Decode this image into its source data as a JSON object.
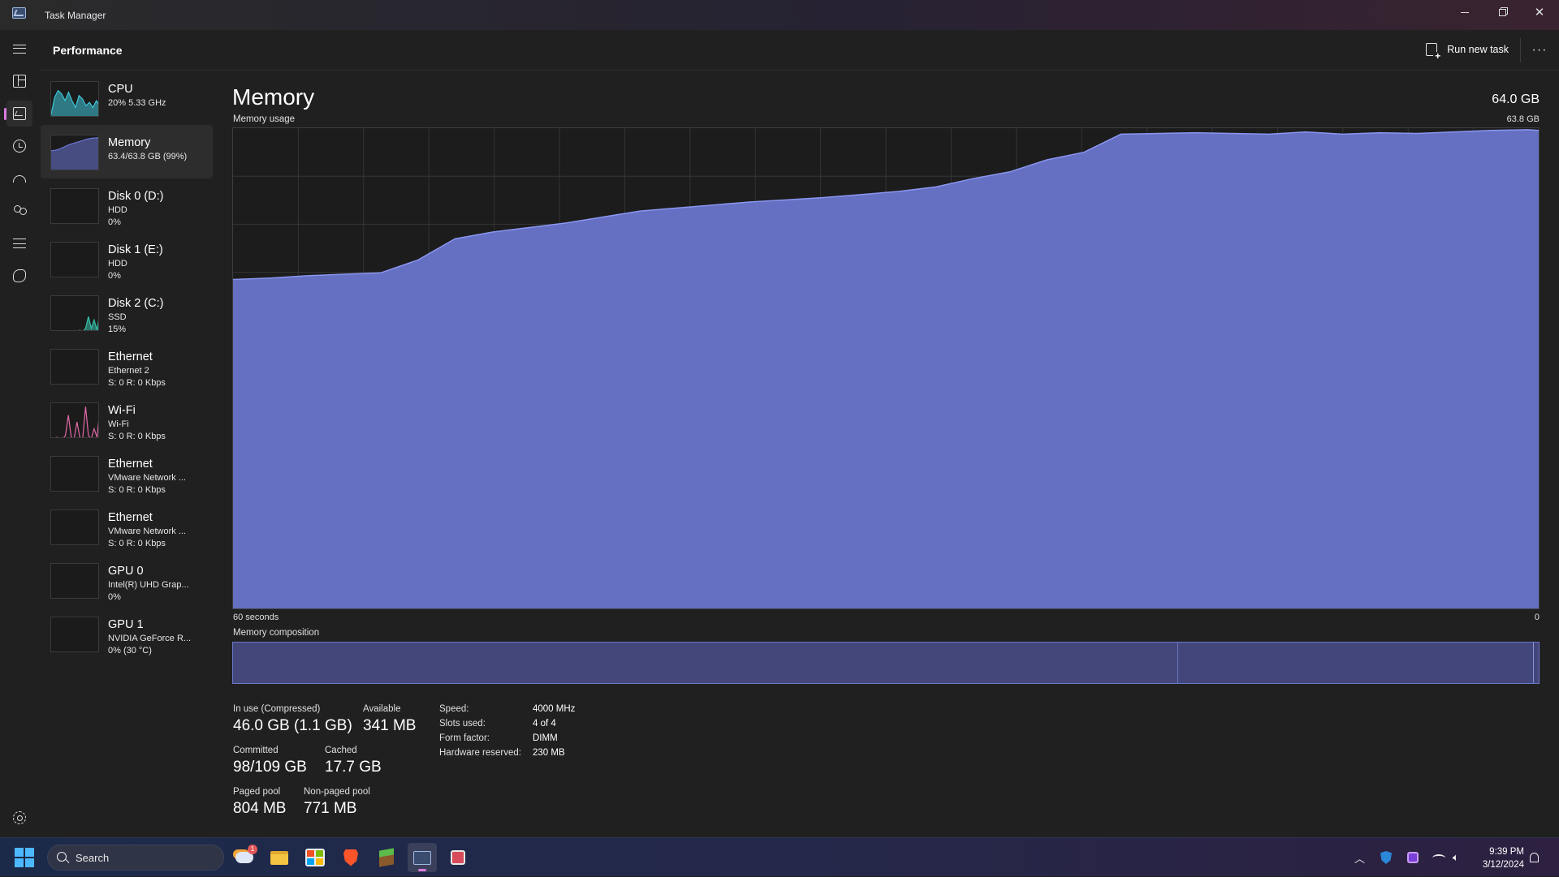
{
  "window": {
    "title": "Task Manager",
    "controls": [
      "minimize",
      "restore",
      "close"
    ]
  },
  "header": {
    "page_title": "Performance",
    "run_new_task": "Run new task",
    "more": "···"
  },
  "nav": {
    "items": [
      {
        "name": "hamburger-menu",
        "icon": "hamburger-icon"
      },
      {
        "name": "processes",
        "icon": "processes-icon"
      },
      {
        "name": "performance",
        "icon": "performance-icon",
        "active": true
      },
      {
        "name": "app-history",
        "icon": "history-icon"
      },
      {
        "name": "startup-apps",
        "icon": "speedometer-icon"
      },
      {
        "name": "users",
        "icon": "users-icon"
      },
      {
        "name": "details",
        "icon": "list-icon"
      },
      {
        "name": "services",
        "icon": "puzzle-icon"
      },
      {
        "name": "settings",
        "icon": "gear-icon"
      }
    ]
  },
  "resources": [
    {
      "name": "CPU",
      "sub": "20%  5.33 GHz",
      "sub2": "",
      "color": "#3ec6d9",
      "spark": [
        0.1,
        0.6,
        0.8,
        0.7,
        0.5,
        0.75,
        0.5,
        0.3,
        0.65,
        0.55,
        0.35,
        0.45,
        0.3,
        0.5,
        0.35
      ],
      "fill": true
    },
    {
      "name": "Memory",
      "sub": "63.4/63.8 GB (99%)",
      "sub2": "",
      "color": "#6b77d6",
      "spark": [
        0.6,
        0.62,
        0.66,
        0.72,
        0.78,
        0.82,
        0.86,
        0.9,
        0.94,
        0.97,
        0.98,
        0.99
      ],
      "fill": true,
      "active": true
    },
    {
      "name": "Disk 0 (D:)",
      "sub": "HDD",
      "sub2": "0%",
      "color": "#4fbf6a",
      "spark": [
        0,
        0,
        0,
        0,
        0,
        0,
        0,
        0
      ],
      "fill": false
    },
    {
      "name": "Disk 1 (E:)",
      "sub": "HDD",
      "sub2": "0%",
      "color": "#4fbf6a",
      "spark": [
        0,
        0,
        0,
        0,
        0,
        0,
        0,
        0
      ],
      "fill": false
    },
    {
      "name": "Disk 2 (C:)",
      "sub": "SSD",
      "sub2": "15%",
      "color": "#36c0a8",
      "spark": [
        0,
        0,
        0,
        0,
        0,
        0,
        0.02,
        0,
        0,
        0,
        0.05,
        0,
        0.1,
        0.45,
        0.1,
        0.35,
        0.05,
        0.55
      ],
      "fill": true
    },
    {
      "name": "Ethernet",
      "sub": "Ethernet 2",
      "sub2": "S: 0 R: 0 Kbps",
      "color": "#d070a8",
      "spark": [
        0,
        0,
        0,
        0,
        0,
        0,
        0,
        0
      ],
      "fill": false
    },
    {
      "name": "Wi-Fi",
      "sub": "Wi-Fi",
      "sub2": "S: 0 R: 0 Kbps",
      "color": "#e06aa8",
      "spark": [
        0,
        0,
        0.05,
        0,
        0,
        0.1,
        0.7,
        0.05,
        0,
        0.5,
        0.05,
        0,
        0.95,
        0.1,
        0,
        0.3,
        0.05,
        0.85
      ],
      "fill": false
    },
    {
      "name": "Ethernet",
      "sub": "VMware Network ...",
      "sub2": "S: 0 R: 0 Kbps",
      "color": "#d070a8",
      "spark": [
        0,
        0,
        0,
        0,
        0,
        0,
        0,
        0
      ],
      "fill": false
    },
    {
      "name": "Ethernet",
      "sub": "VMware Network ...",
      "sub2": "S: 0 R: 0 Kbps",
      "color": "#d070a8",
      "spark": [
        0,
        0,
        0,
        0,
        0,
        0,
        0,
        0
      ],
      "fill": false
    },
    {
      "name": "GPU 0",
      "sub": "Intel(R) UHD Grap...",
      "sub2": "0%",
      "color": "#3a7bd5",
      "spark": [
        0,
        0,
        0,
        0,
        0,
        0,
        0,
        0
      ],
      "fill": false
    },
    {
      "name": "GPU 1",
      "sub": "NVIDIA GeForce R...",
      "sub2": "0% (30 °C)",
      "color": "#3a7bd5",
      "spark": [
        0,
        0,
        0,
        0,
        0,
        0.02,
        0,
        0.02
      ],
      "fill": false
    }
  ],
  "main": {
    "title": "Memory",
    "total": "64.0 GB",
    "usage_label": "Memory usage",
    "usage_max": "63.8 GB",
    "axis_left": "60 seconds",
    "axis_right": "0",
    "composition_label": "Memory composition",
    "composition": {
      "in_use_fraction": 0.724,
      "modified_fraction": 0.272,
      "standby_fraction": 0.004
    },
    "fill_color": "#6570c2",
    "line_color": "#8a96f0"
  },
  "chart_data": {
    "type": "area",
    "ylabel": "Memory usage",
    "ylim": [
      0,
      63.8
    ],
    "xlim": [
      60,
      0
    ],
    "x": [
      60,
      58.3,
      56.6,
      54.9,
      53.2,
      51.5,
      49.8,
      48.1,
      46.4,
      44.7,
      43,
      41.3,
      39.6,
      37.9,
      36.2,
      34.5,
      32.8,
      31.1,
      29.4,
      27.7,
      26,
      24.3,
      22.6,
      20.9,
      19.2,
      17.5,
      15.8,
      14.1,
      12.4,
      10.7,
      9,
      7.3,
      5.6,
      3.9,
      2.2,
      0.5,
      0
    ],
    "values": [
      43.7,
      43.9,
      44.2,
      44.4,
      44.6,
      46.3,
      49.1,
      50.0,
      50.6,
      51.2,
      52.0,
      52.8,
      53.2,
      53.6,
      54.0,
      54.3,
      54.6,
      55.0,
      55.4,
      56.0,
      57.1,
      58.0,
      59.6,
      60.6,
      63.0,
      63.1,
      63.2,
      63.1,
      63.0,
      63.3,
      63.0,
      63.2,
      63.1,
      63.3,
      63.5,
      63.6,
      63.5
    ],
    "grid": true
  },
  "stats": [
    {
      "label": "In use (Compressed)",
      "value": "46.0 GB (1.1 GB)"
    },
    {
      "label": "Available",
      "value": "341 MB"
    },
    {
      "label": "Committed",
      "value": "98/109 GB"
    },
    {
      "label": "Cached",
      "value": "17.7 GB"
    },
    {
      "label": "Paged pool",
      "value": "804 MB"
    },
    {
      "label": "Non-paged pool",
      "value": "771 MB"
    }
  ],
  "specs": [
    {
      "label": "Speed:",
      "value": "4000 MHz"
    },
    {
      "label": "Slots used:",
      "value": "4 of 4"
    },
    {
      "label": "Form factor:",
      "value": "DIMM"
    },
    {
      "label": "Hardware reserved:",
      "value": "230 MB"
    }
  ],
  "taskbar": {
    "search_placeholder": "Search",
    "weather_badge": "1",
    "apps": [
      {
        "name": "weather-app",
        "icon": "weather-icon",
        "color": "#f2a33a"
      },
      {
        "name": "file-explorer",
        "icon": "folder-icon",
        "color": "#f4c542"
      },
      {
        "name": "microsoft-store",
        "icon": "store-icon",
        "color": "#2b88d8"
      },
      {
        "name": "brave-browser",
        "icon": "brave-lion-icon",
        "color": "#fb542b"
      },
      {
        "name": "minecraft",
        "icon": "grass-block-icon",
        "color": "#5dbb4b"
      },
      {
        "name": "task-manager",
        "icon": "task-manager-icon",
        "color": "#6b9ae8",
        "active": true
      },
      {
        "name": "snipping-tool",
        "icon": "snipping-tool-icon",
        "color": "#d84b5b"
      }
    ],
    "time": "9:39 PM",
    "date": "3/12/2024"
  }
}
